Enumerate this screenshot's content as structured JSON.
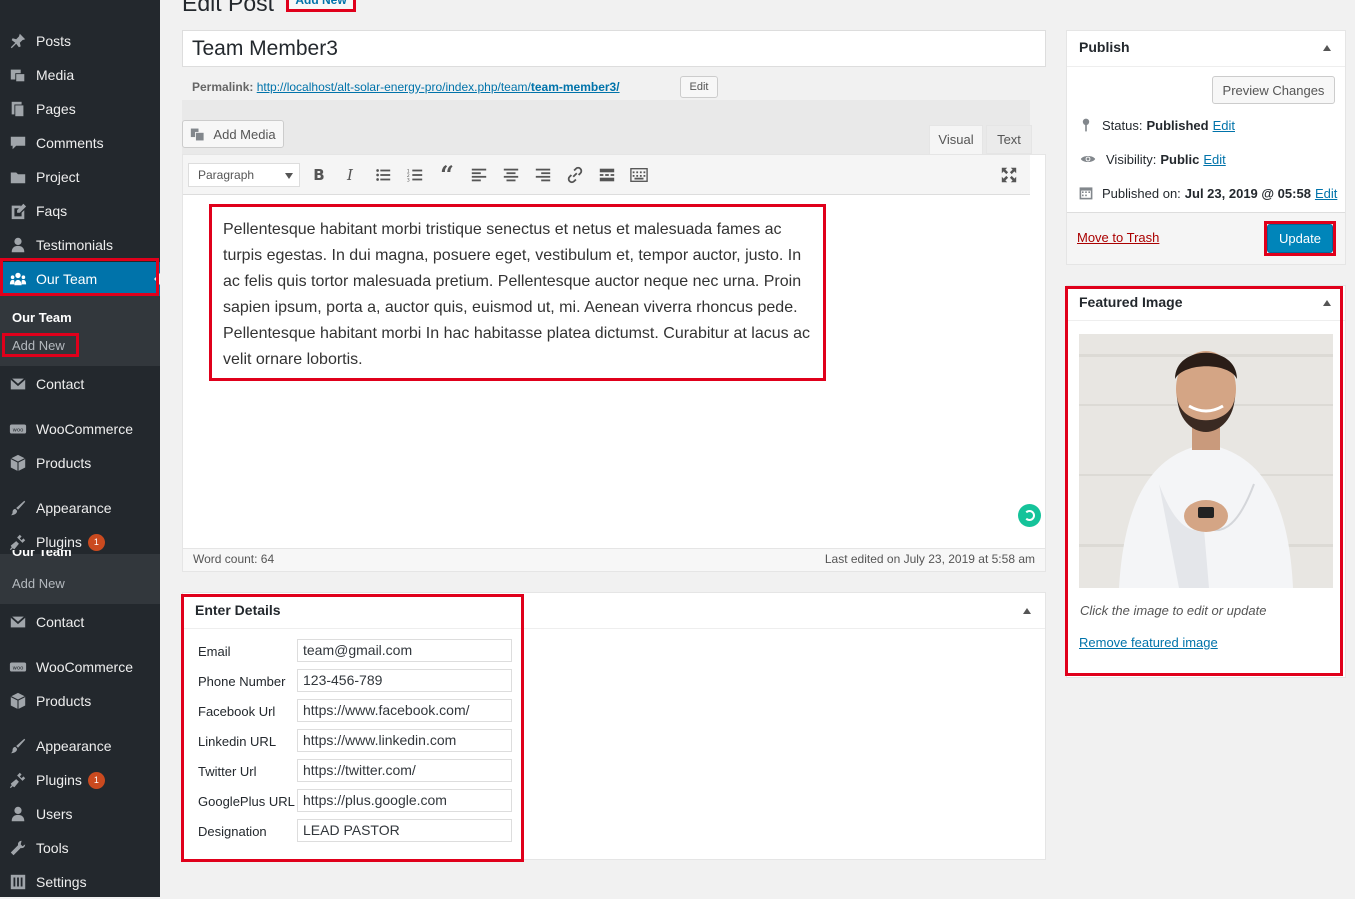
{
  "sidebar": {
    "items_top": [
      {
        "label": "Posts",
        "icon": "pin-icon"
      },
      {
        "label": "Media",
        "icon": "media-icon"
      },
      {
        "label": "Pages",
        "icon": "pages-icon"
      },
      {
        "label": "Comments",
        "icon": "comments-icon"
      },
      {
        "label": "Project",
        "icon": "folder-icon"
      },
      {
        "label": "Faqs",
        "icon": "faqs-icon"
      },
      {
        "label": "Testimonials",
        "icon": "person-icon"
      },
      {
        "label": "Our Team",
        "icon": "team-icon"
      }
    ],
    "our_team_sub": {
      "title": "Our Team",
      "add_new": "Add New"
    },
    "items_mid": [
      {
        "label": "Contact",
        "icon": "mail-icon"
      },
      {
        "label": "WooCommerce",
        "icon": "woo-icon"
      },
      {
        "label": "Products",
        "icon": "box-icon"
      },
      {
        "label": "Appearance",
        "icon": "brush-icon"
      },
      {
        "label": "Plugins",
        "icon": "plug-icon",
        "badge": "1"
      }
    ],
    "dup_sub": {
      "title": "Our Team",
      "add_new": "Add New"
    },
    "items_bottom": [
      {
        "label": "Contact",
        "icon": "mail-icon"
      },
      {
        "label": "WooCommerce",
        "icon": "woo-icon"
      },
      {
        "label": "Products",
        "icon": "box-icon"
      },
      {
        "label": "Appearance",
        "icon": "brush-icon"
      },
      {
        "label": "Plugins",
        "icon": "plug-icon",
        "badge": "1"
      },
      {
        "label": "Users",
        "icon": "users-icon"
      },
      {
        "label": "Tools",
        "icon": "wrench-icon"
      },
      {
        "label": "Settings",
        "icon": "settings-icon"
      }
    ]
  },
  "header": {
    "title": "Edit Post",
    "add_new": "Add New"
  },
  "post": {
    "title": "Team Member3",
    "permalink_label": "Permalink:",
    "permalink_base": "http://localhost/alt-solar-energy-pro/index.php/team/",
    "permalink_slug": "team-member3/",
    "permalink_edit": "Edit"
  },
  "editor": {
    "add_media": "Add Media",
    "tab_visual": "Visual",
    "tab_text": "Text",
    "format_select": "Paragraph",
    "content": "Pellentesque habitant morbi tristique senectus et netus et malesuada fames ac turpis egestas. In dui magna, posuere eget, vestibulum et, tempor auctor, justo. In ac felis quis tortor malesuada pretium. Pellentesque auctor neque nec urna. Proin sapien ipsum, porta a, auctor quis, euismod ut, mi. Aenean viverra rhoncus pede. Pellentesque habitant morbi In hac habitasse platea dictumst. Curabitur at lacus ac velit ornare lobortis.",
    "word_count": "Word count: 64",
    "last_edited": "Last edited on July 23, 2019 at 5:58 am"
  },
  "details": {
    "title": "Enter Details",
    "fields": [
      {
        "label": "Email",
        "value": "team@gmail.com"
      },
      {
        "label": "Phone Number",
        "value": "123-456-789"
      },
      {
        "label": "Facebook Url",
        "value": "https://www.facebook.com/"
      },
      {
        "label": "Linkedin URL",
        "value": "https://www.linkedin.com"
      },
      {
        "label": "Twitter Url",
        "value": "https://twitter.com/"
      },
      {
        "label": "GooglePlus URL",
        "value": "https://plus.google.com"
      },
      {
        "label": "Designation",
        "value": "LEAD PASTOR"
      }
    ]
  },
  "publish": {
    "title": "Publish",
    "preview": "Preview Changes",
    "status_label": "Status:",
    "status_value": "Published",
    "visibility_label": "Visibility:",
    "visibility_value": "Public",
    "published_label": "Published on:",
    "published_value": "Jul 23, 2019 @ 05:58",
    "edit": "Edit",
    "trash": "Move to Trash",
    "update": "Update"
  },
  "featured": {
    "title": "Featured Image",
    "hint": "Click the image to edit or update",
    "remove": "Remove featured image"
  },
  "colors": {
    "sidebar": "#23282d",
    "active": "#0073aa",
    "highlight": "#e0001b",
    "primary_btn": "#0085ba"
  }
}
